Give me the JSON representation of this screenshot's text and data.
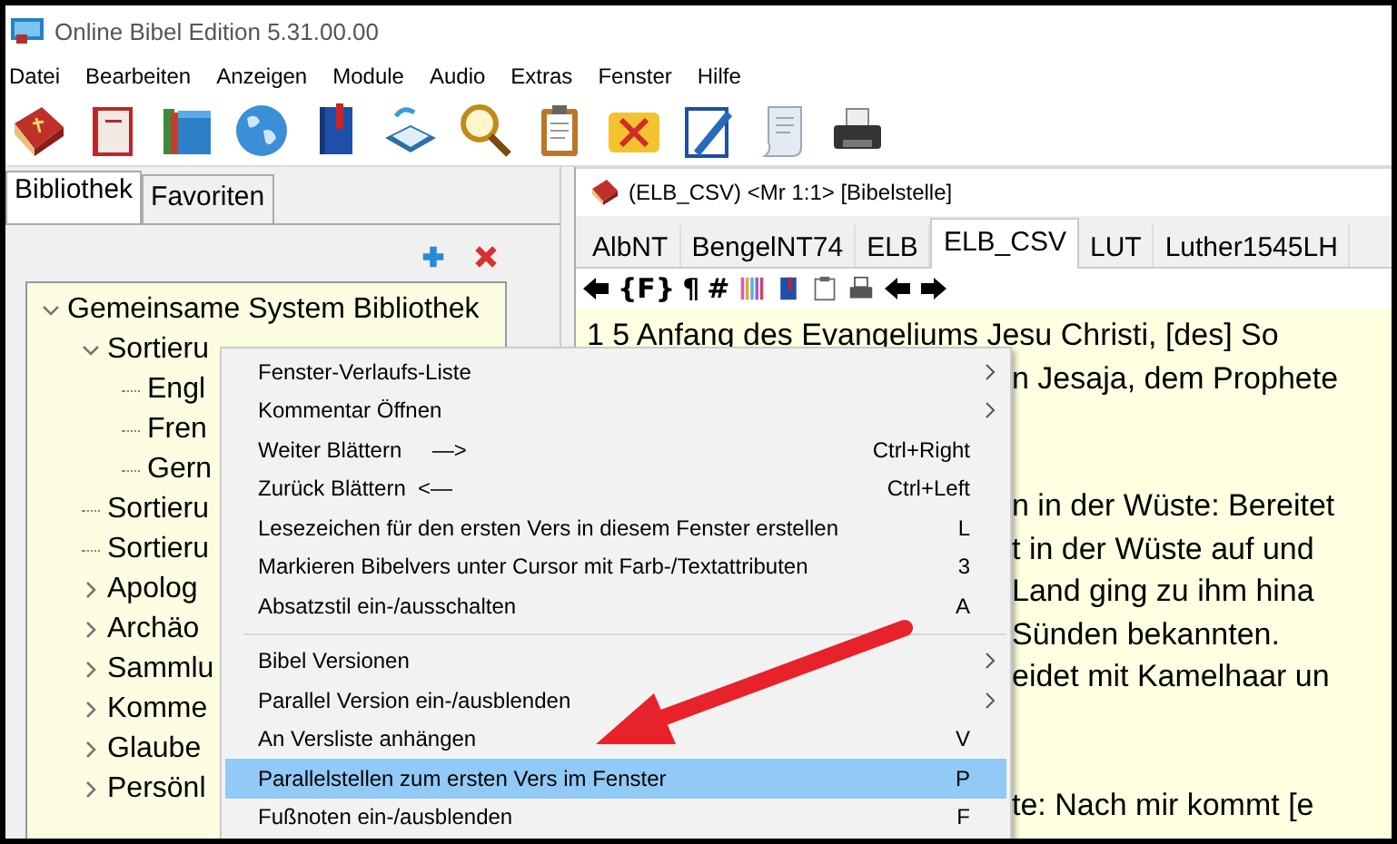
{
  "window": {
    "title": "Online Bibel Edition 5.31.00.00"
  },
  "menu_bar": [
    "Datei",
    "Bearbeiten",
    "Anzeigen",
    "Module",
    "Audio",
    "Extras",
    "Fenster",
    "Hilfe"
  ],
  "library_tabs": [
    {
      "label": "Bibliothek",
      "selected": true
    },
    {
      "label": "Favoriten",
      "selected": false
    }
  ],
  "tree": [
    {
      "label": "Gemeinsame System Bibliothek",
      "kind": "folder",
      "expanded": true,
      "children": [
        {
          "label": "Sortieru",
          "kind": "folder",
          "expanded": true,
          "children": [
            {
              "label": "Engl",
              "kind": "leaf"
            },
            {
              "label": "Fren",
              "kind": "leaf"
            },
            {
              "label": "Gern",
              "kind": "leaf"
            }
          ]
        },
        {
          "label": "Sortieru",
          "kind": "leaf"
        },
        {
          "label": "Sortieru",
          "kind": "leaf"
        },
        {
          "label": "Apolog",
          "kind": "folder",
          "expanded": false
        },
        {
          "label": "Archäo",
          "kind": "folder",
          "expanded": false
        },
        {
          "label": "Sammlu",
          "kind": "folder",
          "expanded": false
        },
        {
          "label": "Komme",
          "kind": "folder",
          "expanded": false
        },
        {
          "label": "Glaube",
          "kind": "folder",
          "expanded": false
        },
        {
          "label": "Persönl",
          "kind": "folder",
          "expanded": false
        }
      ]
    }
  ],
  "bible_window": {
    "title": "(ELB_CSV) <Mr 1:1> [Bibelstelle]",
    "tabs": [
      {
        "label": "AlbNT",
        "selected": false
      },
      {
        "label": "BengelNT74",
        "selected": false
      },
      {
        "label": "ELB",
        "selected": false
      },
      {
        "label": "ELB_CSV",
        "selected": true
      },
      {
        "label": "LUT",
        "selected": false
      },
      {
        "label": "Luther1545LH",
        "selected": false
      }
    ],
    "toolbar": {
      "footnotes": "{F}",
      "paragraph": "¶",
      "numbers": "#"
    },
    "paragraphs": [
      {
        "lines": [
          "1 5 Anfang des Evangeliums Jesu Christi, [des] So",
          "n Jesaja, dem Prophete"
        ]
      },
      {
        "lines": [
          "n in der Wüste: Bereitet",
          "t in der Wüste auf und",
          "Land ging zu ihm hina",
          "Sünden bekannten.",
          "eidet mit Kamelhaar un"
        ]
      },
      {
        "lines": [
          "te: Nach mir kommt [e"
        ]
      }
    ]
  },
  "context_menu": [
    {
      "kind": "item",
      "label": "Fenster-Verlaufs-Liste",
      "submenu": true,
      "selected": false
    },
    {
      "kind": "item",
      "label": "Kommentar Öffnen",
      "submenu": true,
      "selected": false
    },
    {
      "kind": "item",
      "label": "Weiter Blättern     —>",
      "shortcut": "Ctrl+Right",
      "submenu": false,
      "selected": false
    },
    {
      "kind": "item",
      "label": "Zurück Blättern  <—",
      "shortcut": "Ctrl+Left",
      "submenu": false,
      "selected": false
    },
    {
      "kind": "item",
      "label": "Lesezeichen für den ersten Vers in diesem Fenster erstellen",
      "shortcut": "L",
      "submenu": false,
      "selected": false
    },
    {
      "kind": "item",
      "label": "Markieren Bibelvers unter Cursor mit Farb-/Textattributen",
      "shortcut": "3",
      "submenu": false,
      "selected": false
    },
    {
      "kind": "item",
      "label": "Absatzstil ein-/ausschalten",
      "shortcut": "A",
      "submenu": false,
      "selected": false
    },
    {
      "kind": "separator"
    },
    {
      "kind": "item",
      "label": "Bibel Versionen",
      "submenu": true,
      "selected": false
    },
    {
      "kind": "item",
      "label": "Parallel Version ein-/ausblenden",
      "submenu": true,
      "selected": false
    },
    {
      "kind": "item",
      "label": "An Versliste anhängen",
      "shortcut": "V",
      "submenu": false,
      "selected": false
    },
    {
      "kind": "item",
      "label": "Parallelstellen zum ersten Vers im Fenster",
      "shortcut": "P",
      "submenu": false,
      "selected": true
    },
    {
      "kind": "item",
      "label": "Fußnoten ein-/ausblenden",
      "shortcut": "F",
      "submenu": false,
      "selected": false
    }
  ]
}
